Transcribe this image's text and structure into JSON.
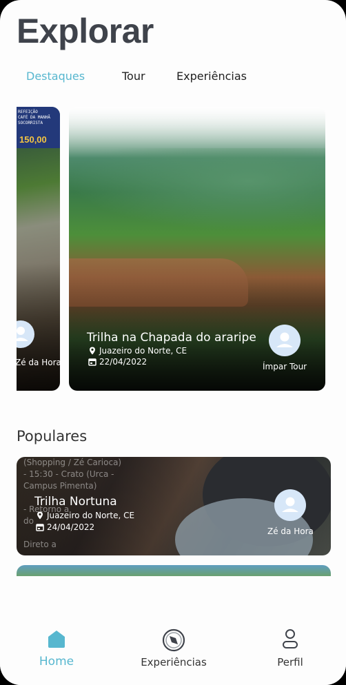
{
  "page": {
    "title": "Explorar"
  },
  "tabs": [
    {
      "label": "Destaques",
      "active": true
    },
    {
      "label": "Tour",
      "active": false
    },
    {
      "label": "Experiências",
      "active": false
    }
  ],
  "highlights": {
    "left_card": {
      "banner_text": "REFEIÇÃO\nCAFÉ DA MANHÃ\nSOCORRISTA",
      "price": "150,00",
      "host_name": "Zé da Hora"
    },
    "main_card": {
      "title": "Trilha na Chapada do araripe",
      "location": "Juazeiro do Norte, CE",
      "date": "22/04/2022",
      "host_name": "Ímpar Tour"
    }
  },
  "popular": {
    "section_title": "Populares",
    "card": {
      "background_text": "(Shopping / Zé Carioca)\n- 15:30 - Crato (Urca -\nCampus Pimenta)\n\n- Retorno a\ndo\n\nDireto a",
      "title": "Trilha Nortuna",
      "location": "Juazeiro do Norte, CE",
      "date": "24/04/2022",
      "host_name": "Zé da Hora"
    }
  },
  "bottom_nav": [
    {
      "label": "Home",
      "icon": "home-icon",
      "active": true
    },
    {
      "label": "Experiências",
      "icon": "compass-icon",
      "active": false
    },
    {
      "label": "Perfil",
      "icon": "user-icon",
      "active": false
    }
  ],
  "colors": {
    "accent": "#57b7cf",
    "title": "#3f434b",
    "avatar_bg": "#d7e7f8"
  }
}
